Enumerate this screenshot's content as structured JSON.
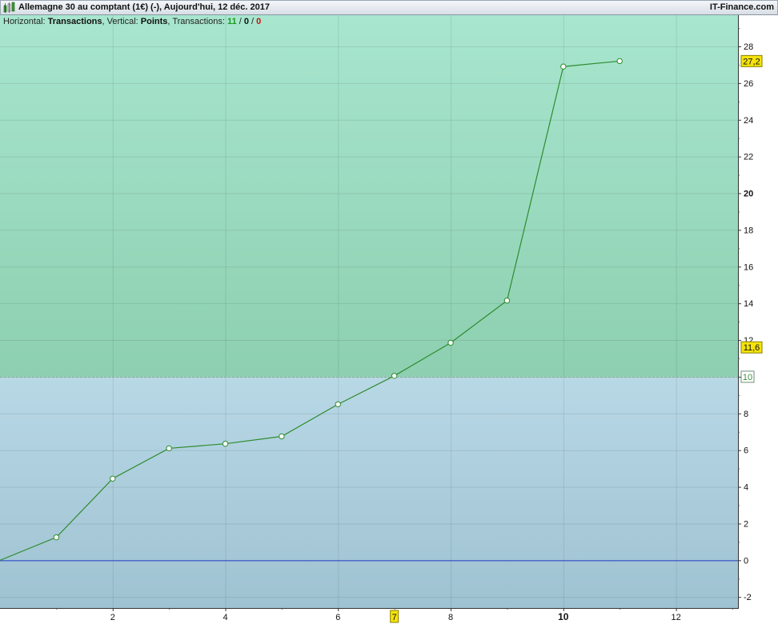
{
  "window": {
    "title": "Allemagne 30 au comptant (1€) (-), Aujourd'hui, 12 déc. 2017",
    "brand": "IT-Finance.com",
    "icon": "candlestick-chart-icon"
  },
  "info_bar": {
    "horizontal_label": "Horizontal: ",
    "horizontal_value": "Transactions",
    "vertical_label": ", Vertical: ",
    "vertical_value": "Points",
    "transactions_label": ", Transactions: ",
    "transactions_win": "11",
    "sep1": " / ",
    "transactions_neutral": "0",
    "sep2": " / ",
    "transactions_loss": "0"
  },
  "chart_data": {
    "type": "line",
    "x": [
      0,
      1,
      2,
      3,
      4,
      5,
      6,
      7,
      8,
      9,
      10,
      11
    ],
    "series": [
      {
        "values": [
          0,
          1.25,
          4.45,
          6.1,
          6.35,
          6.75,
          8.5,
          10.05,
          11.85,
          14.15,
          26.9,
          27.2
        ]
      }
    ],
    "xlim": [
      0,
      13.1
    ],
    "ylim": [
      -2.6,
      29.7
    ],
    "x_ticks": [
      "2",
      "4",
      "6",
      "8",
      "10",
      "12"
    ],
    "x_tick_values": [
      2,
      4,
      6,
      8,
      10,
      12
    ],
    "x_bold_tick": "10",
    "y_ticks": [
      "-2",
      "0",
      "2",
      "4",
      "6",
      "8",
      "10",
      "12",
      "14",
      "16",
      "18",
      "20",
      "22",
      "24",
      "26",
      "28"
    ],
    "y_tick_values": [
      -2,
      0,
      2,
      4,
      6,
      8,
      10,
      12,
      14,
      16,
      18,
      20,
      22,
      24,
      26,
      28
    ],
    "y_bold_tick": "20",
    "threshold": {
      "value": 10,
      "label": "10"
    },
    "zero_line": 0,
    "last_value_label": {
      "value": 27.2,
      "text": "27,2"
    },
    "marker_label": {
      "value": 11.6,
      "text": "11,6"
    },
    "x_marker": {
      "value": 7,
      "text": "7"
    },
    "grid": true,
    "colors": {
      "line": "#2e8b2e",
      "zero_line": "#1f3fc8",
      "upper_zone_top": "#a8e6cf",
      "upper_zone_bottom": "#8dcfb0",
      "lower_zone_top": "#b8d8e6",
      "lower_zone_bottom": "#9fc2d1",
      "label_bg": "#f5e30a"
    }
  }
}
